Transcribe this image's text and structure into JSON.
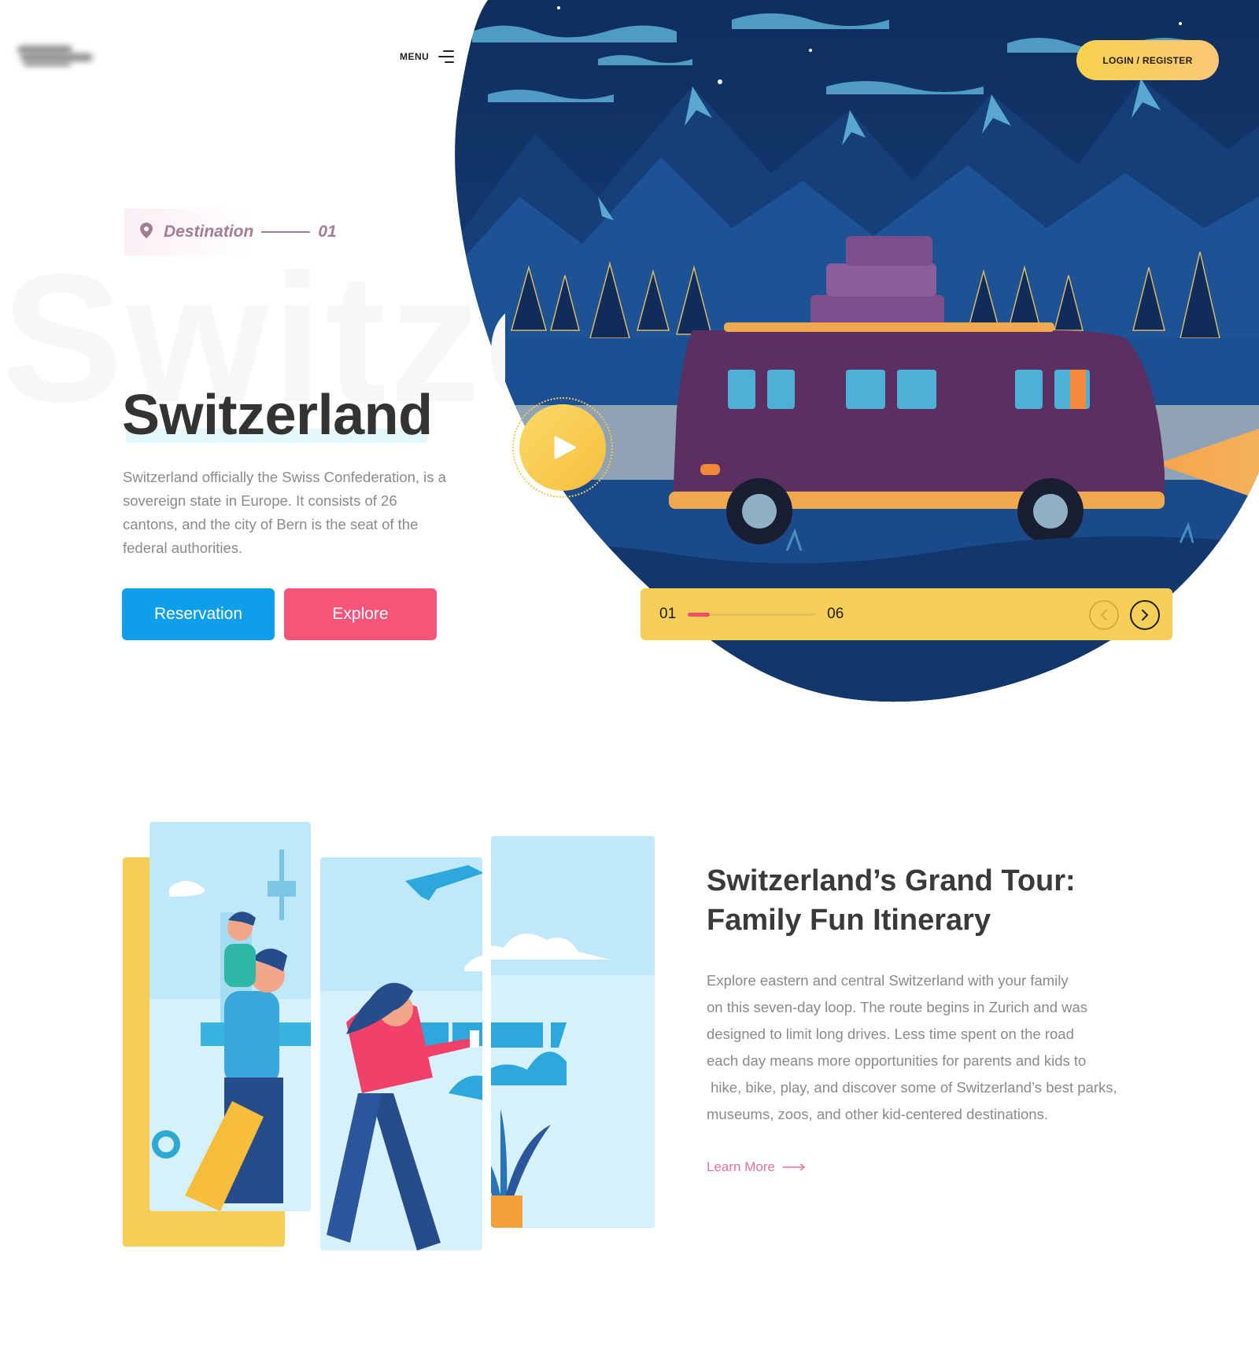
{
  "header": {
    "menu_label": "MENU",
    "login_label": "LOGIN / REGISTER"
  },
  "hero": {
    "watermark": "Switze",
    "tag_label": "Destination",
    "tag_number": "01",
    "title": "Switzerland",
    "description": "Switzerland officially the Swiss Confederation, is a sovereign state in Europe. It consists of 26 cantons, and the city of Bern is the seat of the federal authorities.",
    "reservation_label": "Reservation",
    "explore_label": "Explore"
  },
  "slider": {
    "current": "01",
    "total": "06",
    "progress": 0.17
  },
  "feature": {
    "title_line1": "Switzerland’s Grand Tour:",
    "title_line2": "Family Fun Itinerary",
    "body_lines": [
      "Explore eastern and central Switzerland with your family",
      "on this seven-day loop. The route begins in Zurich and was",
      "designed to limit long drives. Less time spent on the road",
      "each day means more opportunities for parents and kids to",
      " hike, bike, play, and discover some of Switzerland’s best parks,",
      "museums, zoos, and other kid-centered destinations."
    ],
    "link_label": "Learn More"
  },
  "colors": {
    "blue_button": "#0e9eea",
    "pink_button": "#f65478",
    "yellow": "#f5cf58",
    "link_pink": "#e8719a"
  },
  "icons": [
    "menu-icon",
    "location-pin-icon",
    "play-icon",
    "chevron-left-icon",
    "chevron-right-icon",
    "arrow-right-icon"
  ]
}
